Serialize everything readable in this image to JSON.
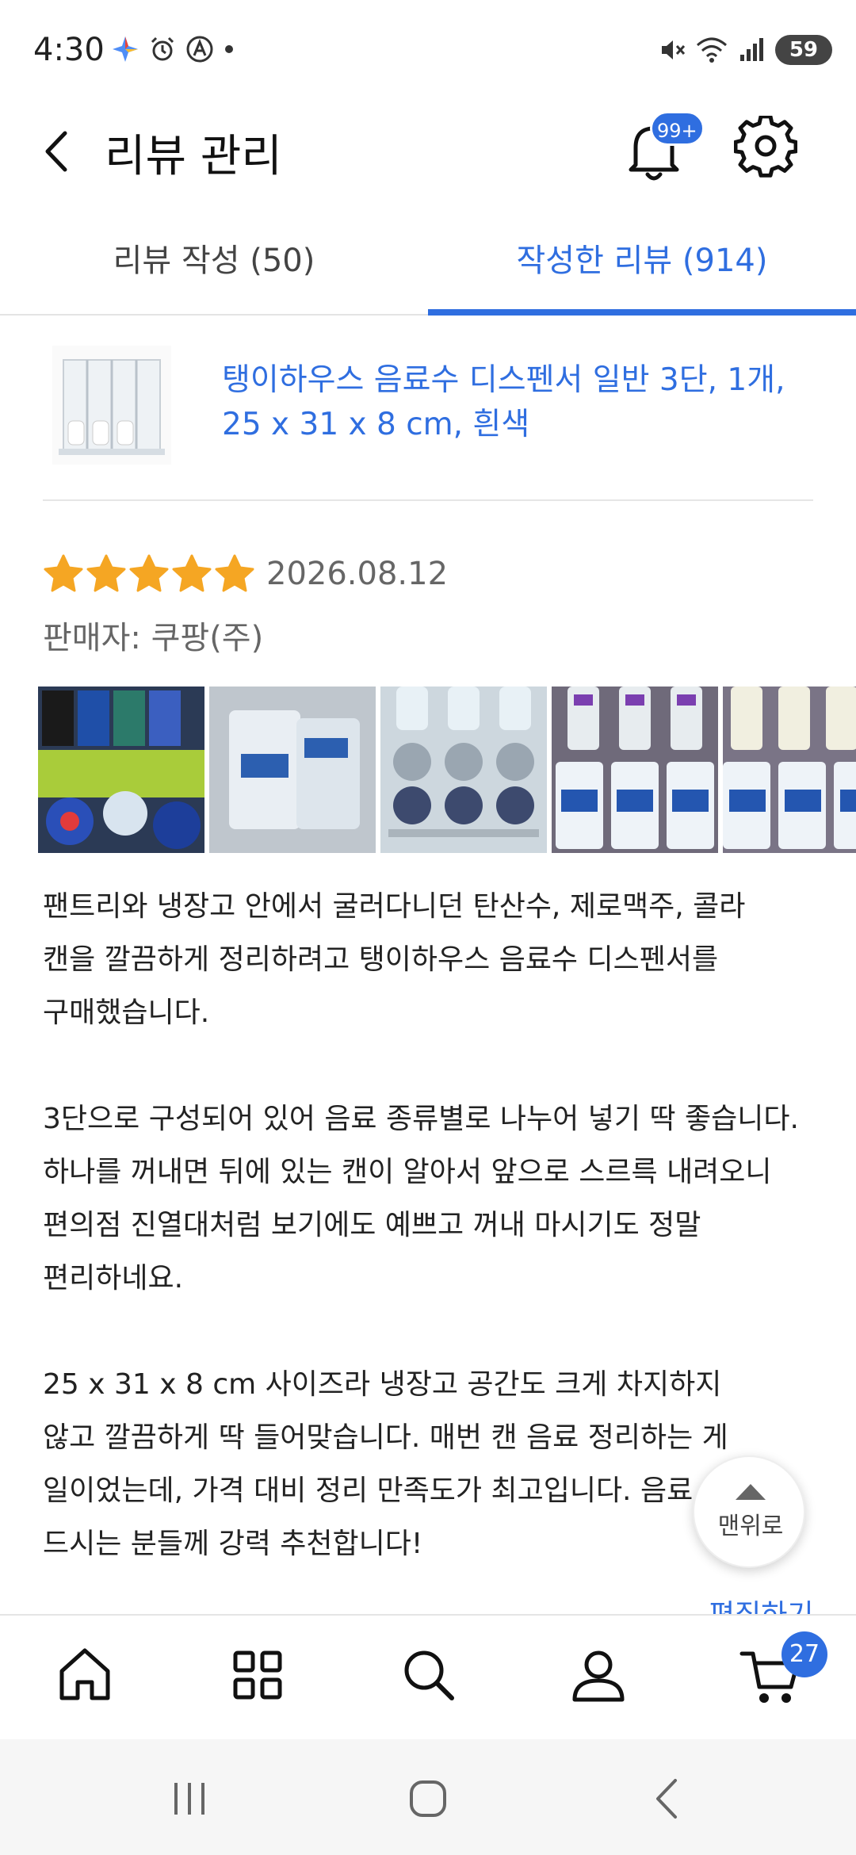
{
  "status_bar": {
    "time": "4:30",
    "battery": "59"
  },
  "header": {
    "title": "리뷰 관리",
    "notification_badge": "99+"
  },
  "tabs": [
    {
      "label": "리뷰 작성 (50)",
      "active": false
    },
    {
      "label": "작성한 리뷰 (914)",
      "active": true
    }
  ],
  "product": {
    "name_line1": "탱이하우스 음료수 디스펜서 일반 3단, 1개,",
    "name_line2": "25 x 31 x 8 cm, 흰색"
  },
  "review": {
    "rating": 5,
    "date": "2026.08.12",
    "seller": "판매자: 쿠팡(주)",
    "paragraphs": [
      [
        "팬트리와 냉장고 안에서 굴러다니던 탄산수, 제로맥주, 콜라",
        "캔을 깔끔하게 정리하려고 탱이하우스 음료수 디스펜서를",
        "구매했습니다."
      ],
      [
        "3단으로 구성되어 있어 음료 종류별로 나누어 넣기 딱 좋습니다.",
        "하나를 꺼내면 뒤에 있는 캔이 알아서 앞으로 스르륵 내려오니",
        "편의점 진열대처럼 보기에도 예쁘고 꺼내 마시기도 정말",
        "편리하네요."
      ],
      [
        "25 x 31 x 8 cm 사이즈라 냉장고 공간도 크게 차지하지",
        "않고 깔끔하게 딱 들어맞습니다. 매번 캔 음료 정리하는 게",
        "일이었는데, 가격 대비 정리 만족도가 최고입니다. 음료 자주",
        "드시는 분들께 강력 추천합니다!"
      ]
    ]
  },
  "to_top_label": "맨위로",
  "edit_label": "편집하기",
  "bottom_nav": {
    "items": [
      "home-icon",
      "category-icon",
      "search-icon",
      "account-icon",
      "cart-icon"
    ],
    "cart_badge": "27"
  },
  "colors": {
    "accent": "#2f6ee0",
    "star": "#f5a623",
    "muted_text": "#666666"
  }
}
